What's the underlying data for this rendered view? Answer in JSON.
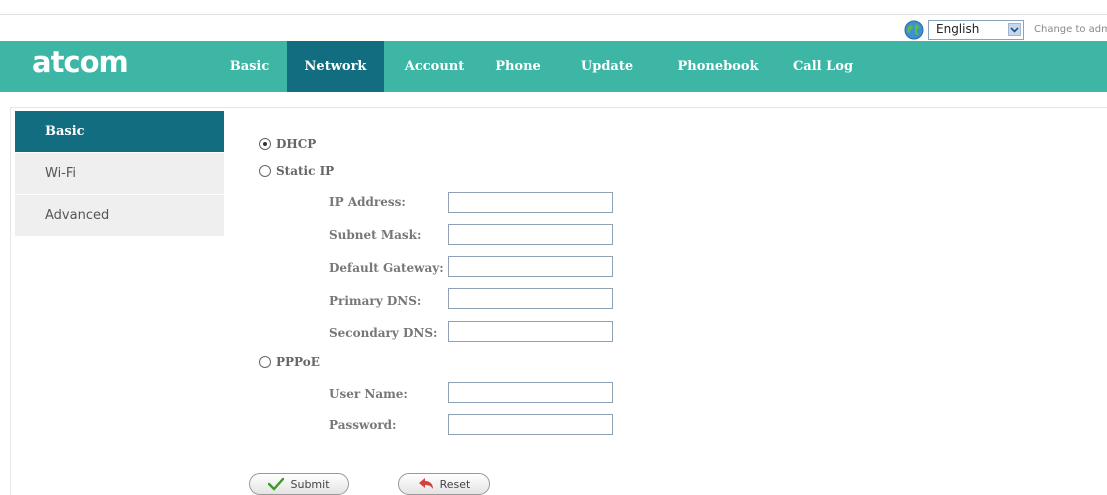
{
  "language": {
    "selected": "English",
    "change_text": "Change to admin"
  },
  "logo": "atcom",
  "nav": {
    "items": [
      {
        "label": "Basic"
      },
      {
        "label": "Network"
      },
      {
        "label": "Account"
      },
      {
        "label": "Phone"
      },
      {
        "label": "Update"
      },
      {
        "label": "Phonebook"
      },
      {
        "label": "Call Log"
      }
    ],
    "active": "Network"
  },
  "sidebar": {
    "items": [
      {
        "label": "Basic"
      },
      {
        "label": "Wi-Fi"
      },
      {
        "label": "Advanced"
      }
    ],
    "active": "Basic"
  },
  "form": {
    "dhcp_label": "DHCP",
    "static_label": "Static IP",
    "pppoe_label": "PPPoE",
    "selected_mode": "DHCP",
    "static": {
      "ip_address_label": "IP Address:",
      "ip_address_value": "",
      "subnet_mask_label": "Subnet Mask:",
      "subnet_mask_value": "",
      "gateway_label": "Default Gateway:",
      "gateway_value": "",
      "primary_dns_label": "Primary DNS:",
      "primary_dns_value": "",
      "secondary_dns_label": "Secondary DNS:",
      "secondary_dns_value": ""
    },
    "pppoe": {
      "user_label": "User Name:",
      "user_value": "",
      "password_label": "Password:",
      "password_value": ""
    }
  },
  "buttons": {
    "submit": "Submit",
    "reset": "Reset"
  },
  "colors": {
    "nav_bg": "#3db6a5",
    "nav_active": "#126d80",
    "sidebar_bg": "#efefef"
  }
}
